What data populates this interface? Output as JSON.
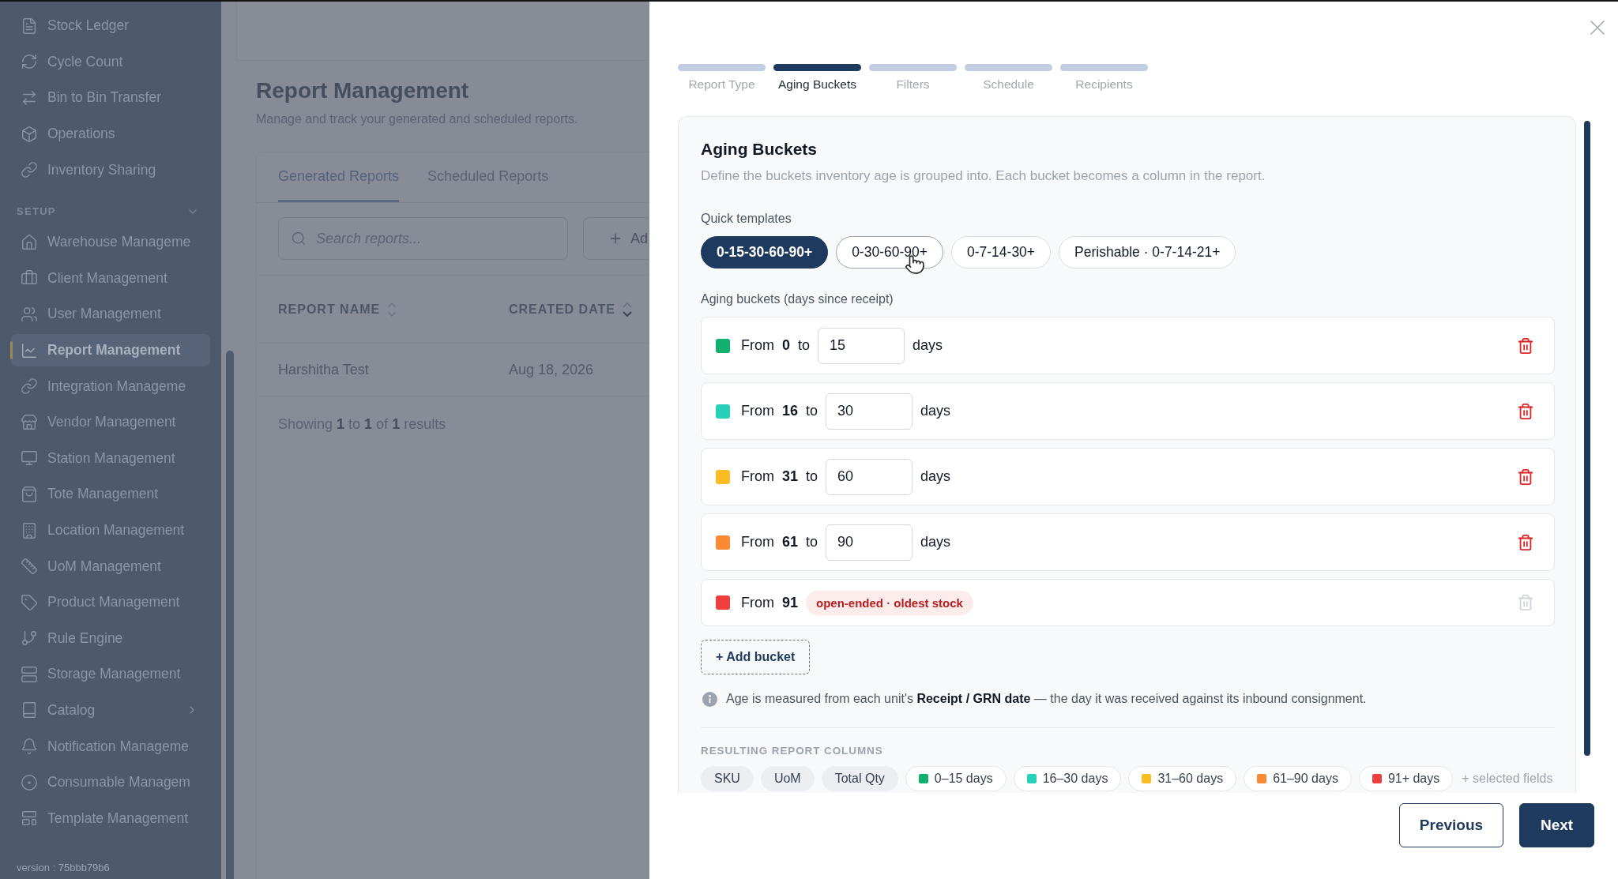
{
  "sidebar": {
    "items": [
      {
        "label": "Stock Ledger",
        "kind": "link",
        "selected": false
      },
      {
        "label": "Cycle Count",
        "kind": "link",
        "selected": false
      },
      {
        "label": "Bin to Bin Transfer",
        "kind": "link",
        "selected": false
      },
      {
        "label": "Operations",
        "kind": "link",
        "selected": false
      },
      {
        "label": "Inventory Sharing",
        "kind": "link",
        "selected": false
      }
    ],
    "sections": [
      {
        "label": "SETUP",
        "expanded": true,
        "items": [
          {
            "label": "Warehouse Manageme",
            "kind": "link",
            "selected": false
          },
          {
            "label": "Client Management",
            "kind": "link",
            "selected": false
          },
          {
            "label": "User Management",
            "kind": "link",
            "selected": false
          },
          {
            "label": "Report Management",
            "kind": "link",
            "selected": true
          },
          {
            "label": "Integration Manageme",
            "kind": "link",
            "selected": false
          },
          {
            "label": "Vendor Management",
            "kind": "link",
            "selected": false
          },
          {
            "label": "Station Management",
            "kind": "link",
            "selected": false
          },
          {
            "label": "Tote Management",
            "kind": "link",
            "selected": false
          },
          {
            "label": "Location Management",
            "kind": "link",
            "selected": false
          },
          {
            "label": "UoM Management",
            "kind": "link",
            "selected": false
          },
          {
            "label": "Product Management",
            "kind": "link",
            "selected": false
          },
          {
            "label": "Rule Engine",
            "kind": "link",
            "selected": false
          },
          {
            "label": "Storage Management",
            "kind": "link",
            "selected": false
          },
          {
            "label": "Catalog",
            "kind": "group",
            "selected": false
          },
          {
            "label": "Notification Manageme",
            "kind": "link",
            "selected": false
          },
          {
            "label": "Consumable Managem",
            "kind": "link",
            "selected": false
          },
          {
            "label": "Template Management",
            "kind": "link",
            "selected": false
          }
        ]
      }
    ],
    "version": "version : 75bbb79b6"
  },
  "page": {
    "title": "Report Management",
    "subtitle": "Manage and track your generated and scheduled reports.",
    "tabs": [
      {
        "label": "Generated Reports",
        "selected": true
      },
      {
        "label": "Scheduled Reports",
        "selected": false
      }
    ],
    "search": {
      "placeholder": "Search reports..."
    },
    "add_button": "Ad",
    "table": {
      "columns": [
        {
          "label": "REPORT NAME",
          "sorted": false
        },
        {
          "label": "CREATED DATE",
          "sorted": true
        }
      ],
      "rows": [
        [
          "Harshitha Test",
          "Aug 18, 2026"
        ]
      ]
    },
    "summary": "Showing **1** to **1** of **1** results"
  },
  "drawer": {
    "steps": [
      {
        "label": "Report Type",
        "selected": false
      },
      {
        "label": "Aging Buckets",
        "selected": true
      },
      {
        "label": "Filters",
        "selected": false
      },
      {
        "label": "Schedule",
        "selected": false
      },
      {
        "label": "Recipients",
        "selected": false
      }
    ],
    "title": "Aging Buckets",
    "description": "Define the buckets inventory age is grouped into. Each bucket becomes a column in the report.",
    "templates_label": "Quick templates",
    "templates": [
      {
        "label": "0-15-30-60-90+",
        "selected": true,
        "hovered": false
      },
      {
        "label": "0-30-60-90+",
        "selected": false,
        "hovered": true
      },
      {
        "label": "0-7-14-30+",
        "selected": false,
        "hovered": false
      },
      {
        "label": "Perishable · 0-7-14-21+",
        "selected": false,
        "hovered": false
      }
    ],
    "buckets_label": "Aging buckets (days since receipt)",
    "buckets": [
      {
        "kind": "range",
        "color": "#12b06e",
        "from_label": "From",
        "from": "0",
        "to_label": "to",
        "to": "15",
        "unit": "days",
        "delete_disabled": false
      },
      {
        "kind": "range",
        "color": "#27d1b9",
        "from_label": "From",
        "from": "16",
        "to_label": "to",
        "to": "30",
        "unit": "days",
        "delete_disabled": false
      },
      {
        "kind": "range",
        "color": "#fbbd23",
        "from_label": "From",
        "from": "31",
        "to_label": "to",
        "to": "60",
        "unit": "days",
        "delete_disabled": false
      },
      {
        "kind": "range",
        "color": "#fb8a34",
        "from_label": "From",
        "from": "61",
        "to_label": "to",
        "to": "90",
        "unit": "days",
        "delete_disabled": false
      },
      {
        "kind": "open",
        "color": "#ef3e3e",
        "from_label": "From",
        "from": "91",
        "badge": "open-ended · oldest stock",
        "delete_disabled": true
      }
    ],
    "add_bucket": "+ Add bucket",
    "note": "Age is measured from each unit's **Receipt / GRN date** — the day it was received against its inbound consignment.",
    "columns_label": "RESULTING REPORT COLUMNS",
    "columns": [
      {
        "kind": "field",
        "label": "SKU"
      },
      {
        "kind": "field",
        "label": "UoM"
      },
      {
        "kind": "field",
        "label": "Total Qty"
      },
      {
        "kind": "bucket",
        "label": "0–15 days",
        "color": "#12b06e"
      },
      {
        "kind": "bucket",
        "label": "16–30 days",
        "color": "#27d1b9"
      },
      {
        "kind": "bucket",
        "label": "31–60 days",
        "color": "#fbbd23"
      },
      {
        "kind": "bucket",
        "label": "61–90 days",
        "color": "#fb8a34"
      },
      {
        "kind": "bucket",
        "label": "91+ days",
        "color": "#ef3e3e"
      }
    ],
    "columns_more": "+ selected fields",
    "buttons": [
      {
        "kind": "secondary",
        "label": "Previous"
      },
      {
        "kind": "primary",
        "label": "Next"
      }
    ]
  }
}
